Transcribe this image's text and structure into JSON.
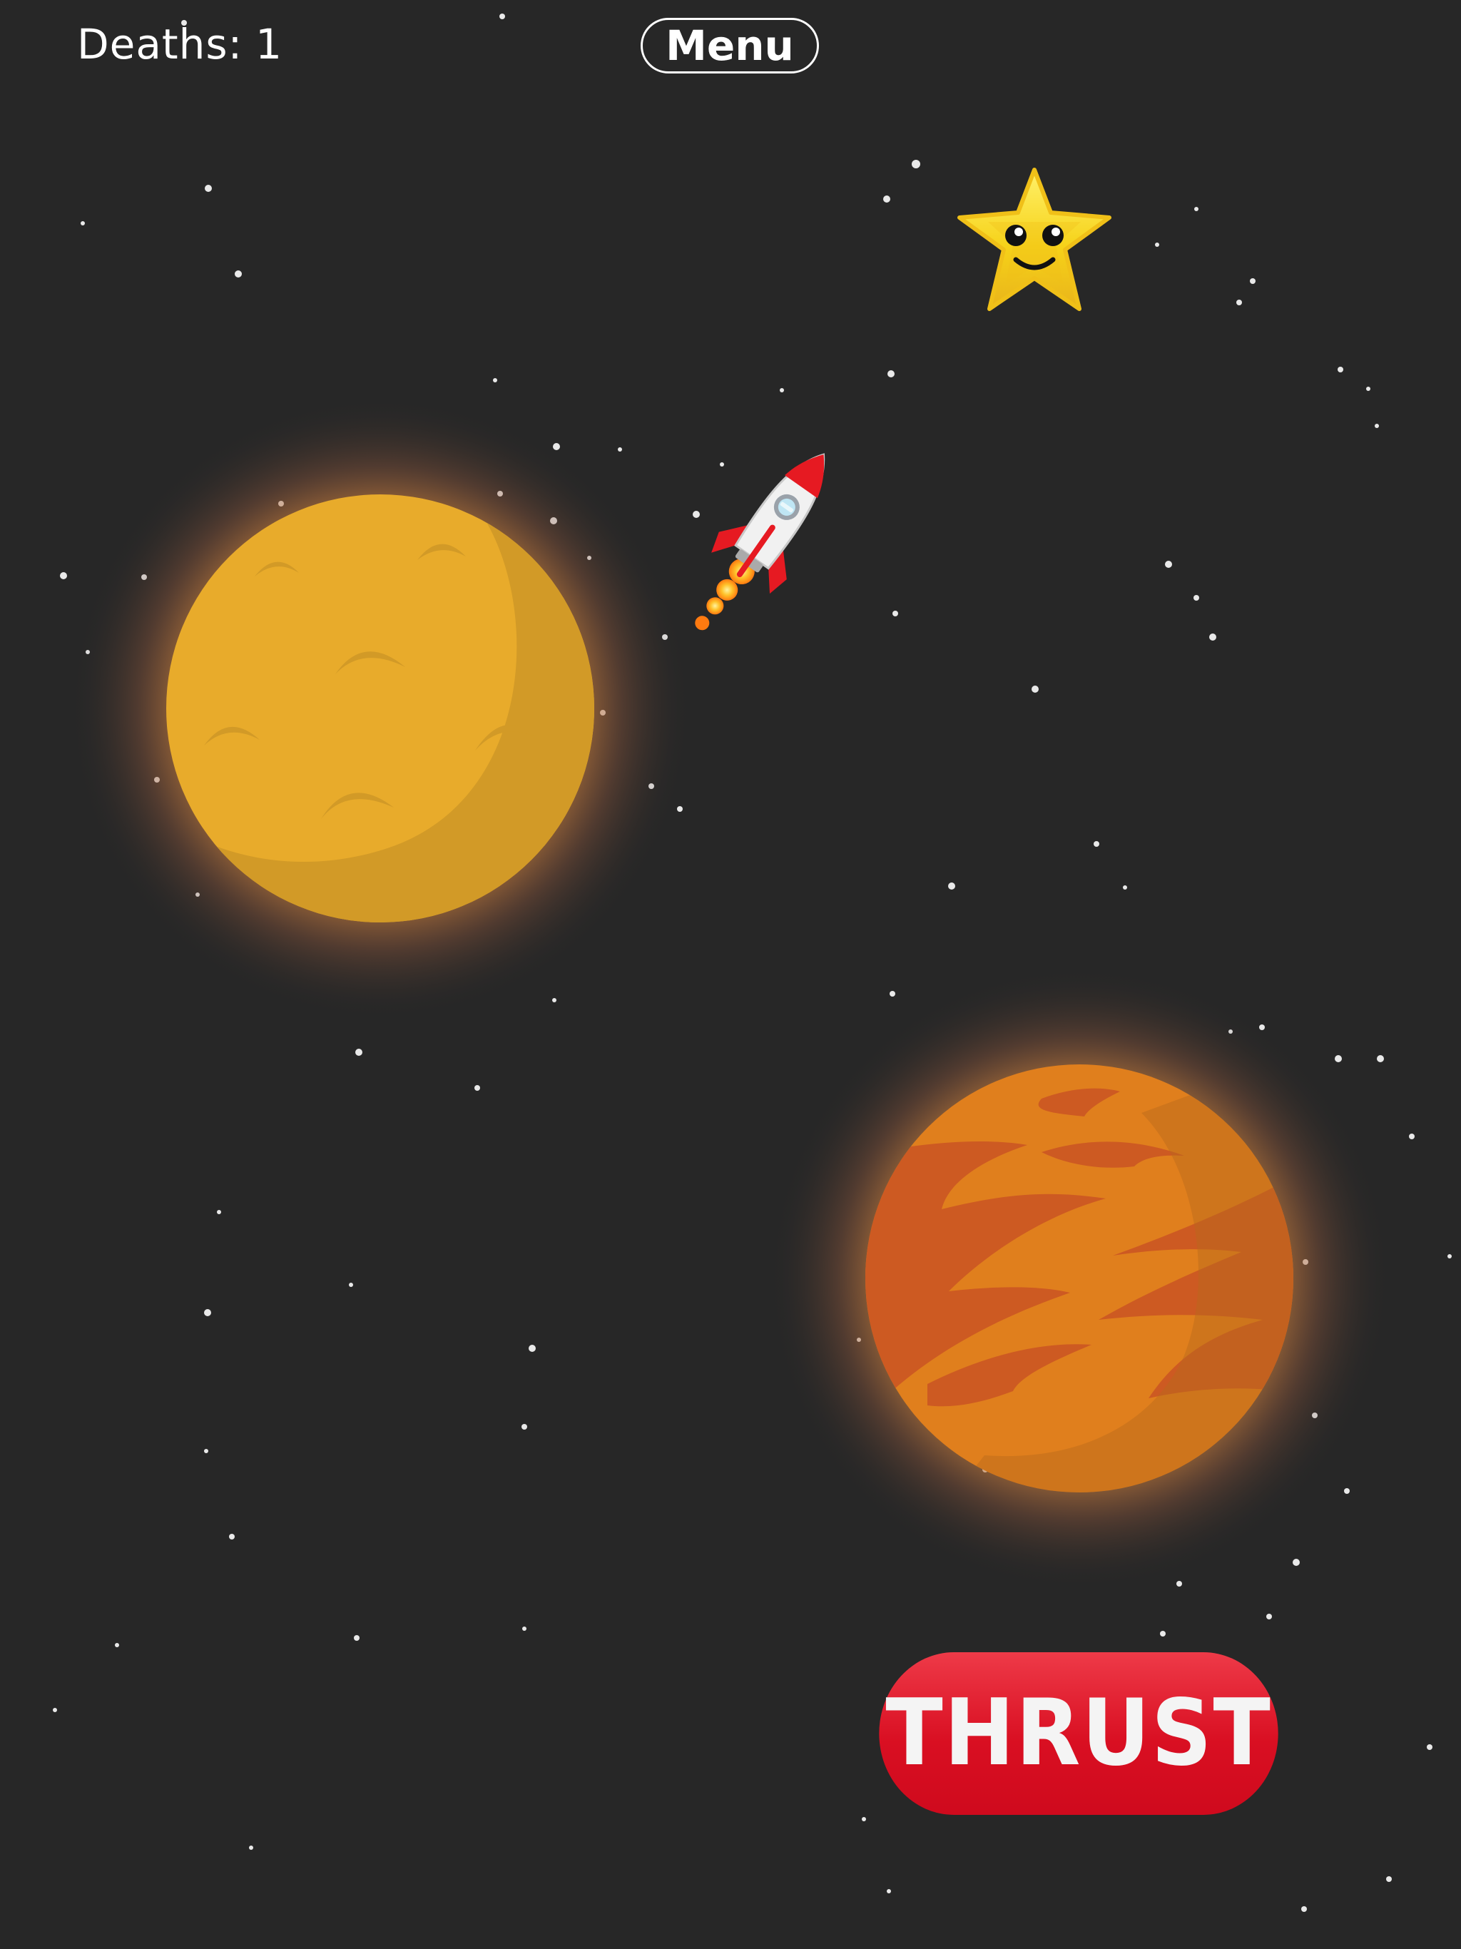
{
  "hud": {
    "deaths_label": "Deaths:",
    "deaths_count": "1",
    "menu_label": "Menu"
  },
  "controls": {
    "thrust_label": "THRUST"
  },
  "scene": {
    "background_color": "#272727",
    "objects": [
      {
        "name": "yellow-moon-planet",
        "color": "#e8ab2b"
      },
      {
        "name": "orange-striped-planet",
        "color": "#e07f1d"
      },
      {
        "name": "rocket-ship",
        "color": "#e61a22"
      },
      {
        "name": "smiling-star-goal",
        "color": "#f7d51c"
      }
    ]
  },
  "colors": {
    "thrust_button": "#d90f22",
    "text": "#ffffff"
  }
}
